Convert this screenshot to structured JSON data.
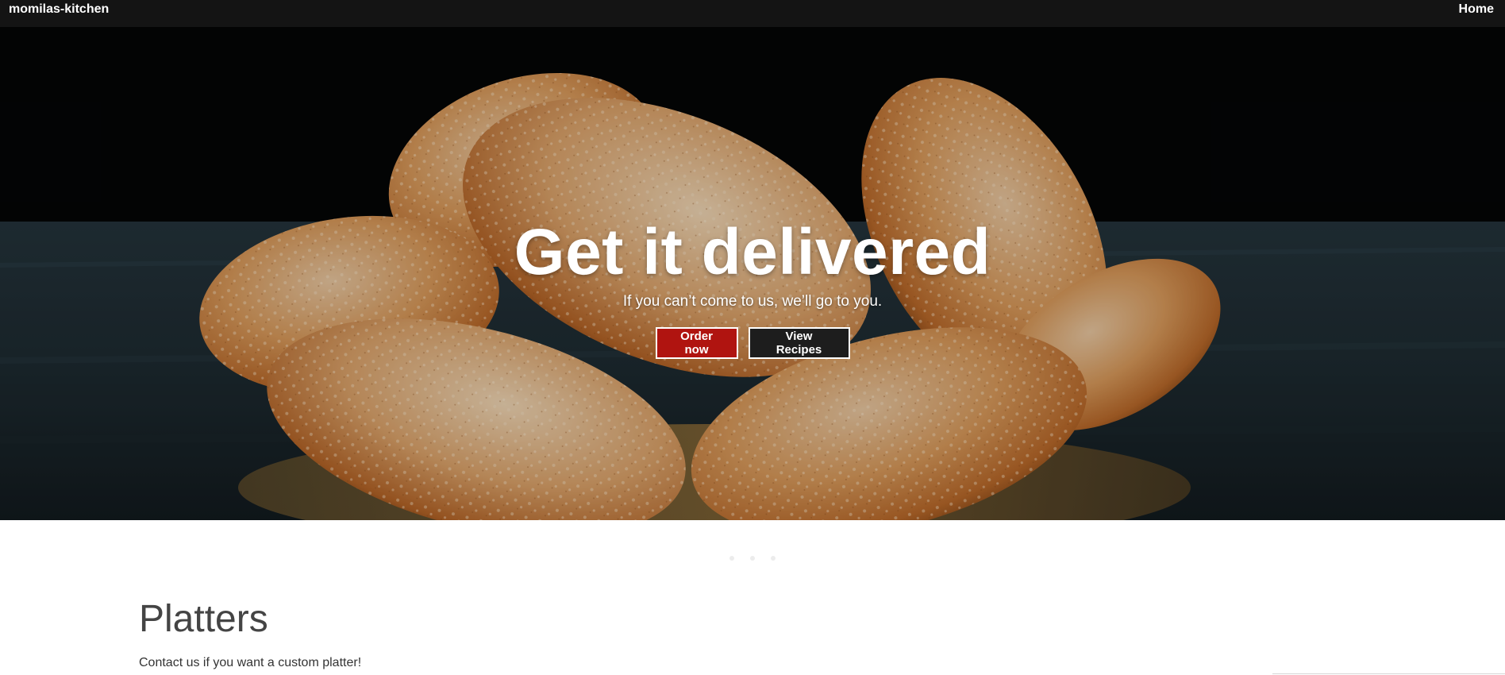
{
  "nav": {
    "brand": "momilas-kitchen",
    "links": [
      "Home"
    ]
  },
  "hero": {
    "title": "Get it delivered",
    "subtitle": "If you can’t come to us, we’ll go to you.",
    "buttons": {
      "order": "Order now",
      "recipes": "View Recipes"
    },
    "image": "fried-puri-bread-photo"
  },
  "carousel": {
    "indicators": 3
  },
  "section": {
    "title": "Platters",
    "description": "Contact us if you want a custom platter!"
  },
  "colors": {
    "nav_bg": "#141414",
    "order_button": "#b01410",
    "recipes_button": "#1d1d1d",
    "heading": "#444444"
  }
}
